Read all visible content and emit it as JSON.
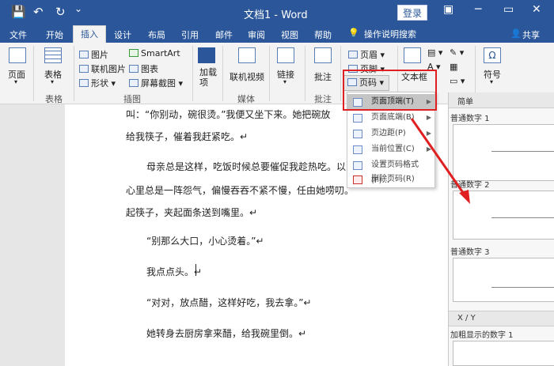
{
  "titlebar": {
    "doc_title": "文档1 - Word",
    "login_label": "登录",
    "save_icon": "💾",
    "undo_icon": "↶",
    "redo_icon": "↻",
    "qa_dropdown_icon": "⌄",
    "minimize_icon": "─",
    "restore_icon": "▭",
    "close_icon": "✕",
    "ribbon_display_icon": "▣"
  },
  "tabs": [
    "文件",
    "开始",
    "插入",
    "设计",
    "布局",
    "引用",
    "邮件",
    "审阅",
    "视图",
    "帮助"
  ],
  "active_tab": "插入",
  "tellme": "操作说明搜索",
  "tellme_icon": "💡",
  "share": "共享",
  "share_icon": "👤",
  "ribbon": {
    "pages": "页面",
    "table": "表格",
    "table_group": "表格",
    "pictures": "图片",
    "online_pictures": "联机图片",
    "shapes": "形状",
    "smartart": "SmartArt",
    "chart": "图表",
    "screenshot": "屏幕截图",
    "illustrations_group": "插图",
    "addins": "加载\n项",
    "online_video": "联机视频",
    "media_group": "媒体",
    "link": "链接",
    "comment": "批注",
    "comments_group": "批注",
    "header": "页眉",
    "footer": "页脚",
    "page_number": "页码",
    "textbox": "文本框",
    "symbol": "符号"
  },
  "menu": {
    "items": [
      {
        "label": "页面顶端(T)",
        "has_arrow": true,
        "highlighted": true
      },
      {
        "label": "页面底端(B)",
        "has_arrow": true,
        "highlighted": false
      },
      {
        "label": "页边距(P)",
        "has_arrow": true,
        "highlighted": false
      },
      {
        "label": "当前位置(C)",
        "has_arrow": true,
        "highlighted": false
      },
      {
        "label": "设置页码格式(F)...",
        "has_arrow": false,
        "highlighted": false
      },
      {
        "label": "删除页码(R)",
        "has_arrow": false,
        "highlighted": false
      }
    ]
  },
  "gallery": {
    "header": "简单",
    "items": [
      "普通数字 1",
      "普通数字 2",
      "普通数字 3"
    ],
    "section2": "X / Y",
    "item4": "加粗显示的数字 1"
  },
  "document": {
    "lines": [
      "叫：“你别动，碗很烫。”我便又坐下来。她把碗放",
      "给我筷子，催着我赶紧吃。↵",
      "母亲总是这样，吃饭时候总要催促我趁热吃。以",
      "心里总是一阵怨气，偏慢吞吞不紧不慢，任由她唠叨。",
      "起筷子，夹起面条送到嘴里。↵",
      "“别那么大口，小心烫着。”↵",
      "我点点头。↵",
      "“对对，放点醋，这样好吃，我去拿。”↵",
      "她转身去厨房拿来醋，给我碗里倒。↵"
    ]
  },
  "colors": {
    "brand": "#2b579a",
    "highlight_red": "#e02020"
  }
}
